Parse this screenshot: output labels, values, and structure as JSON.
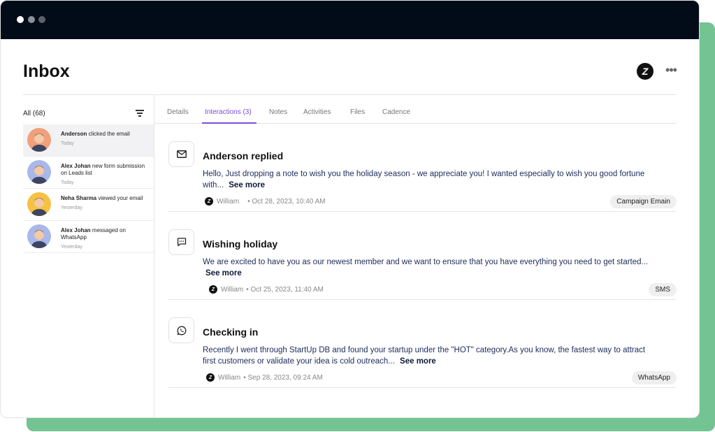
{
  "window": {
    "controls": [
      "close",
      "minimize",
      "maximize"
    ]
  },
  "header": {
    "title": "Inbox",
    "logo_letter": "Z",
    "more_label": "•••"
  },
  "sidebar": {
    "filter_label": "All (68)",
    "contacts": [
      {
        "name": "Anderson",
        "action": "clicked the email",
        "time": "Today",
        "avatar_color": "#f0a07a",
        "active": true
      },
      {
        "name": "Alex Johan",
        "action": "new form submission on Leads list",
        "time": "Today",
        "avatar_color": "#a9b8e8",
        "active": false
      },
      {
        "name": "Neha Sharma",
        "action": "viewed your email",
        "time": "Yesterday",
        "avatar_color": "#f5c242",
        "active": false
      },
      {
        "name": "Alex Johan",
        "action": "messaged on WhatsApp",
        "time": "Yesterday",
        "avatar_color": "#a9b8e8",
        "active": false
      }
    ]
  },
  "tabs": [
    {
      "label": "Details",
      "active": false
    },
    {
      "label": "Interactions (3)",
      "active": true
    },
    {
      "label": "Notes",
      "active": false
    },
    {
      "label": "Activities",
      "active": false
    },
    {
      "label": "Files",
      "active": false
    },
    {
      "label": "Cadence",
      "active": false
    }
  ],
  "interactions": [
    {
      "icon": "mail-icon",
      "title": "Anderson replied",
      "body": "Hello, Just dropping a note to wish you the holiday season - we appreciate you!  I wanted especially to wish you good fortune with...",
      "see_more": "See more",
      "author": "William",
      "time": "• Oct 28, 2023, 10:40 AM",
      "channel": "Campaign Emain"
    },
    {
      "icon": "sms-icon",
      "title": "Wishing holiday",
      "body": "We are excited to have you as our newest member and we want to ensure that you have everything you need to get started...",
      "see_more": "See more",
      "author": "William",
      "time": "• Oct 25, 2023, 11:40 AM",
      "channel": "SMS"
    },
    {
      "icon": "whatsapp-icon",
      "title": "Checking in",
      "body": "Recently I went through StartUp DB and found your startup under the \"HOT\" category.As you know, the fastest way to attract first customers or validate your idea is cold outreach...",
      "see_more": "See more",
      "author": "William",
      "time": "• Sep 28, 2023, 09:24 AM",
      "channel": "WhatsApp"
    }
  ],
  "colors": {
    "accent": "#7a4ddb",
    "titlebar": "#020c18",
    "backdrop": "#73c492"
  }
}
